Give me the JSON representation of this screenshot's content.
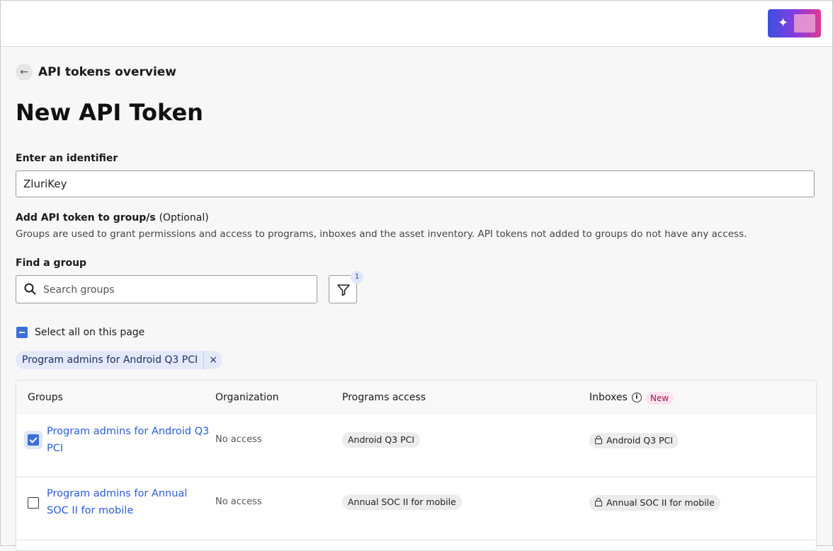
{
  "header": {
    "ai_icon": "sparkles-icon"
  },
  "breadcrumb": {
    "label": "API tokens overview",
    "icon": "arrow-left-icon"
  },
  "page_title": "New API Token",
  "identifier": {
    "label": "Enter an identifier",
    "value": "ZluriKey"
  },
  "groups_section": {
    "label": "Add API token to group/s",
    "optional": "(Optional)",
    "help": "Groups are used to grant permissions and access to programs, inboxes and the asset inventory. API tokens not added to groups do not have any access."
  },
  "find_group": {
    "label": "Find a group",
    "placeholder": "Search groups",
    "filter_count": "1",
    "filter_icon": "filter-icon",
    "search_icon": "search-icon"
  },
  "select_all": {
    "label": "Select all on this page",
    "state": "indeterminate"
  },
  "selected_chip": {
    "label": "Program admins for Android Q3 PCI",
    "remove": "×"
  },
  "table": {
    "columns": {
      "groups": "Groups",
      "organization": "Organization",
      "programs": "Programs access",
      "inboxes": "Inboxes",
      "new_badge": "New"
    },
    "rows": [
      {
        "group": "Program admins for Android Q3 PCI",
        "checked": true,
        "organization": "No access",
        "programs": "Android Q3 PCI",
        "inbox": "Android Q3 PCI"
      },
      {
        "group": "Program admins for Annual SOC II for mobile",
        "checked": false,
        "organization": "No access",
        "programs": "Annual SOC II for mobile",
        "inbox": "Annual SOC II for mobile"
      }
    ]
  },
  "colors": {
    "accent": "#3b6fd8",
    "link": "#2a5bd7",
    "new_badge_bg": "#fde3ee",
    "new_badge_text": "#a4124d"
  }
}
